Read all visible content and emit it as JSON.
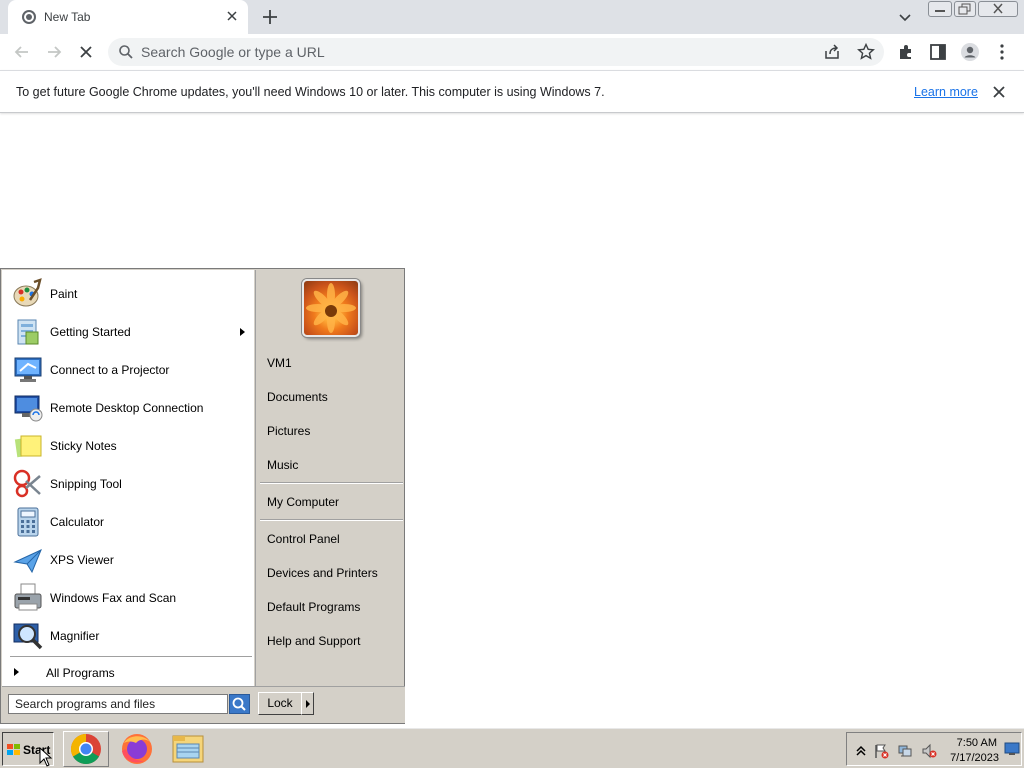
{
  "browser": {
    "tab": {
      "title": "New Tab"
    },
    "omnibox": {
      "placeholder": "Search Google or type a URL"
    },
    "infobar": {
      "message": "To get future Google Chrome updates, you'll need Windows 10 or later. This computer is using Windows 7.",
      "link": "Learn more"
    }
  },
  "start_menu": {
    "programs": [
      {
        "label": "Paint",
        "icon": "paint-icon"
      },
      {
        "label": "Getting Started",
        "icon": "getting-started-icon",
        "has_submenu": true
      },
      {
        "label": "Connect to a Projector",
        "icon": "projector-icon"
      },
      {
        "label": "Remote Desktop Connection",
        "icon": "remote-desktop-icon"
      },
      {
        "label": "Sticky Notes",
        "icon": "sticky-notes-icon"
      },
      {
        "label": "Snipping Tool",
        "icon": "snipping-tool-icon"
      },
      {
        "label": "Calculator",
        "icon": "calculator-icon"
      },
      {
        "label": "XPS Viewer",
        "icon": "xps-viewer-icon"
      },
      {
        "label": "Windows Fax and Scan",
        "icon": "fax-scan-icon"
      },
      {
        "label": "Magnifier",
        "icon": "magnifier-icon"
      }
    ],
    "all_programs": "All Programs",
    "right_pane": {
      "user": "VM1",
      "items_1": [
        "Documents",
        "Pictures",
        "Music"
      ],
      "my_computer": "My Computer",
      "items_2": [
        "Control Panel",
        "Devices and Printers",
        "Default Programs",
        "Help and Support"
      ]
    },
    "search": {
      "placeholder": "Search programs and files"
    },
    "lock_label": "Lock"
  },
  "taskbar": {
    "start_label": "Start",
    "apps": [
      "chrome-icon",
      "firefox-icon",
      "file-explorer-icon"
    ],
    "clock": {
      "time": "7:50 AM",
      "date": "7/17/2023"
    }
  },
  "colors": {
    "chrome_frame": "#dee1e6",
    "link": "#1a73e8",
    "classic_gray": "#d4d0c8"
  }
}
